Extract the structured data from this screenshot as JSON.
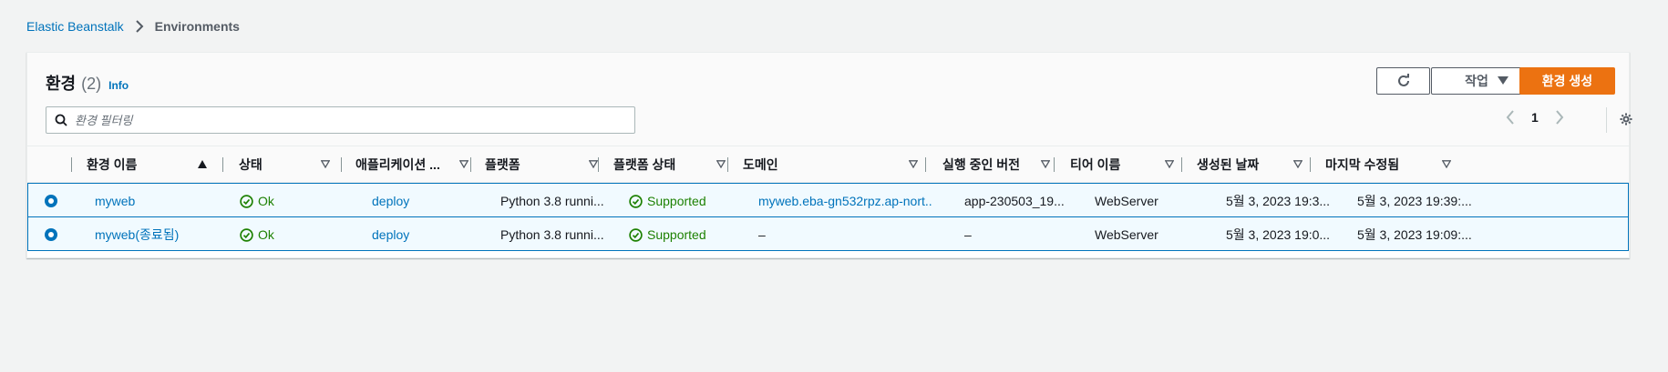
{
  "breadcrumb": {
    "root": "Elastic Beanstalk",
    "current": "Environments"
  },
  "header": {
    "title": "환경",
    "count": "(2)",
    "info": "Info"
  },
  "buttons": {
    "actions": "작업",
    "create": "환경 생성"
  },
  "filter": {
    "placeholder": "환경 필터링"
  },
  "pagination": {
    "page": "1"
  },
  "columns": [
    "환경 이름",
    "상태",
    "애플리케이션 ...",
    "플랫폼",
    "플랫폼 상태",
    "도메인",
    "실행 중인 버전",
    "티어 이름",
    "생성된 날짜",
    "마지막 수정됨"
  ],
  "rows": [
    {
      "name": "myweb",
      "status": "Ok",
      "application": "deploy",
      "platform": "Python 3.8 runni...",
      "platform_status": "Supported",
      "domain": "myweb.eba-gn532rpz.ap-nort...",
      "version": "app-230503_19...",
      "tier": "WebServer",
      "created": "5월 3, 2023 19:3...",
      "modified": "5월 3, 2023 19:39:..."
    },
    {
      "name": "myweb(종료됨)",
      "status": "Ok",
      "application": "deploy",
      "platform": "Python 3.8 runni...",
      "platform_status": "Supported",
      "domain": "–",
      "version": "–",
      "tier": "WebServer",
      "created": "5월 3, 2023 19:0...",
      "modified": "5월 3, 2023 19:09:..."
    }
  ],
  "colors": {
    "link": "#0073bb",
    "ok": "#1d8102",
    "primary": "#ec7211",
    "selected_bg": "#f1faff"
  }
}
